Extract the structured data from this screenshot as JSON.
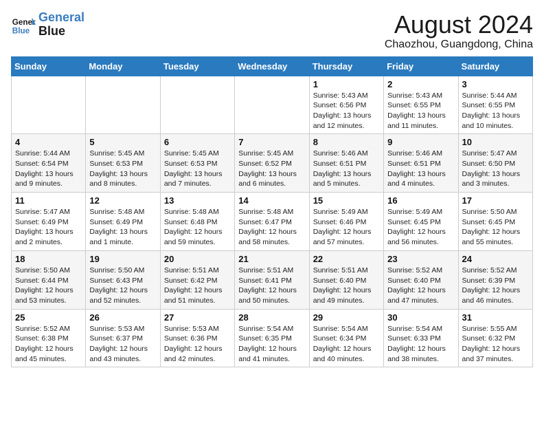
{
  "header": {
    "logo_line1": "General",
    "logo_line2": "Blue",
    "month_year": "August 2024",
    "location": "Chaozhou, Guangdong, China"
  },
  "days_of_week": [
    "Sunday",
    "Monday",
    "Tuesday",
    "Wednesday",
    "Thursday",
    "Friday",
    "Saturday"
  ],
  "weeks": [
    [
      {
        "day": "",
        "info": ""
      },
      {
        "day": "",
        "info": ""
      },
      {
        "day": "",
        "info": ""
      },
      {
        "day": "",
        "info": ""
      },
      {
        "day": "1",
        "info": "Sunrise: 5:43 AM\nSunset: 6:56 PM\nDaylight: 13 hours\nand 12 minutes."
      },
      {
        "day": "2",
        "info": "Sunrise: 5:43 AM\nSunset: 6:55 PM\nDaylight: 13 hours\nand 11 minutes."
      },
      {
        "day": "3",
        "info": "Sunrise: 5:44 AM\nSunset: 6:55 PM\nDaylight: 13 hours\nand 10 minutes."
      }
    ],
    [
      {
        "day": "4",
        "info": "Sunrise: 5:44 AM\nSunset: 6:54 PM\nDaylight: 13 hours\nand 9 minutes."
      },
      {
        "day": "5",
        "info": "Sunrise: 5:45 AM\nSunset: 6:53 PM\nDaylight: 13 hours\nand 8 minutes."
      },
      {
        "day": "6",
        "info": "Sunrise: 5:45 AM\nSunset: 6:53 PM\nDaylight: 13 hours\nand 7 minutes."
      },
      {
        "day": "7",
        "info": "Sunrise: 5:45 AM\nSunset: 6:52 PM\nDaylight: 13 hours\nand 6 minutes."
      },
      {
        "day": "8",
        "info": "Sunrise: 5:46 AM\nSunset: 6:51 PM\nDaylight: 13 hours\nand 5 minutes."
      },
      {
        "day": "9",
        "info": "Sunrise: 5:46 AM\nSunset: 6:51 PM\nDaylight: 13 hours\nand 4 minutes."
      },
      {
        "day": "10",
        "info": "Sunrise: 5:47 AM\nSunset: 6:50 PM\nDaylight: 13 hours\nand 3 minutes."
      }
    ],
    [
      {
        "day": "11",
        "info": "Sunrise: 5:47 AM\nSunset: 6:49 PM\nDaylight: 13 hours\nand 2 minutes."
      },
      {
        "day": "12",
        "info": "Sunrise: 5:48 AM\nSunset: 6:49 PM\nDaylight: 13 hours\nand 1 minute."
      },
      {
        "day": "13",
        "info": "Sunrise: 5:48 AM\nSunset: 6:48 PM\nDaylight: 12 hours\nand 59 minutes."
      },
      {
        "day": "14",
        "info": "Sunrise: 5:48 AM\nSunset: 6:47 PM\nDaylight: 12 hours\nand 58 minutes."
      },
      {
        "day": "15",
        "info": "Sunrise: 5:49 AM\nSunset: 6:46 PM\nDaylight: 12 hours\nand 57 minutes."
      },
      {
        "day": "16",
        "info": "Sunrise: 5:49 AM\nSunset: 6:45 PM\nDaylight: 12 hours\nand 56 minutes."
      },
      {
        "day": "17",
        "info": "Sunrise: 5:50 AM\nSunset: 6:45 PM\nDaylight: 12 hours\nand 55 minutes."
      }
    ],
    [
      {
        "day": "18",
        "info": "Sunrise: 5:50 AM\nSunset: 6:44 PM\nDaylight: 12 hours\nand 53 minutes."
      },
      {
        "day": "19",
        "info": "Sunrise: 5:50 AM\nSunset: 6:43 PM\nDaylight: 12 hours\nand 52 minutes."
      },
      {
        "day": "20",
        "info": "Sunrise: 5:51 AM\nSunset: 6:42 PM\nDaylight: 12 hours\nand 51 minutes."
      },
      {
        "day": "21",
        "info": "Sunrise: 5:51 AM\nSunset: 6:41 PM\nDaylight: 12 hours\nand 50 minutes."
      },
      {
        "day": "22",
        "info": "Sunrise: 5:51 AM\nSunset: 6:40 PM\nDaylight: 12 hours\nand 49 minutes."
      },
      {
        "day": "23",
        "info": "Sunrise: 5:52 AM\nSunset: 6:40 PM\nDaylight: 12 hours\nand 47 minutes."
      },
      {
        "day": "24",
        "info": "Sunrise: 5:52 AM\nSunset: 6:39 PM\nDaylight: 12 hours\nand 46 minutes."
      }
    ],
    [
      {
        "day": "25",
        "info": "Sunrise: 5:52 AM\nSunset: 6:38 PM\nDaylight: 12 hours\nand 45 minutes."
      },
      {
        "day": "26",
        "info": "Sunrise: 5:53 AM\nSunset: 6:37 PM\nDaylight: 12 hours\nand 43 minutes."
      },
      {
        "day": "27",
        "info": "Sunrise: 5:53 AM\nSunset: 6:36 PM\nDaylight: 12 hours\nand 42 minutes."
      },
      {
        "day": "28",
        "info": "Sunrise: 5:54 AM\nSunset: 6:35 PM\nDaylight: 12 hours\nand 41 minutes."
      },
      {
        "day": "29",
        "info": "Sunrise: 5:54 AM\nSunset: 6:34 PM\nDaylight: 12 hours\nand 40 minutes."
      },
      {
        "day": "30",
        "info": "Sunrise: 5:54 AM\nSunset: 6:33 PM\nDaylight: 12 hours\nand 38 minutes."
      },
      {
        "day": "31",
        "info": "Sunrise: 5:55 AM\nSunset: 6:32 PM\nDaylight: 12 hours\nand 37 minutes."
      }
    ]
  ]
}
